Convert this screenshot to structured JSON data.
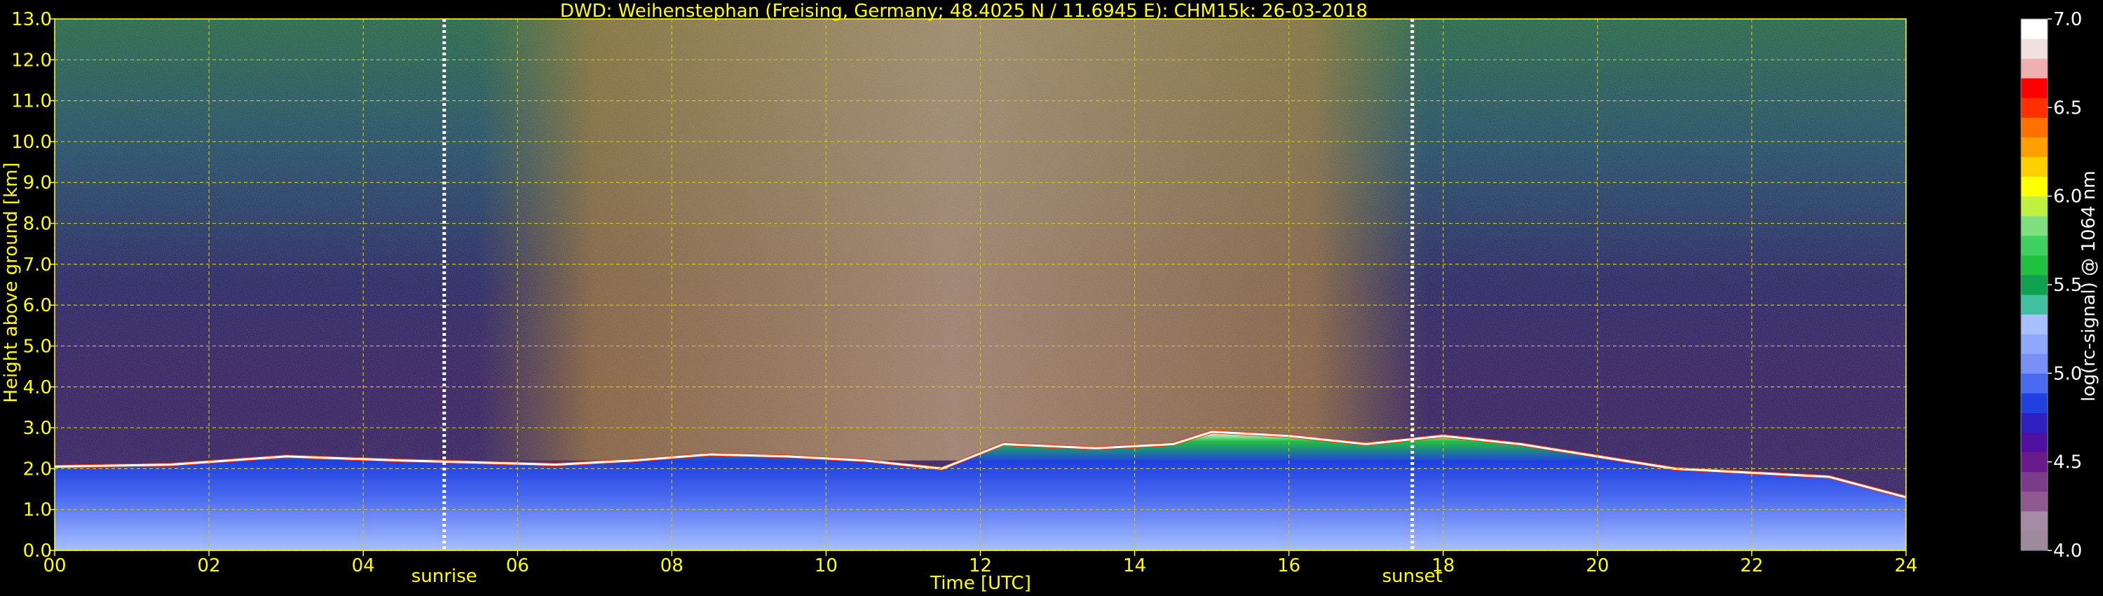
{
  "chart_data": {
    "type": "heatmap",
    "title": "DWD: Weihenstephan (Freising, Germany; 48.4025 N / 11.6945 E):    CHM15k: 26-03-2018",
    "xlabel": "Time [UTC]",
    "ylabel": "Height above ground [km]",
    "xlim": [
      0,
      24
    ],
    "ylim": [
      0,
      13
    ],
    "x_ticks": [
      "00",
      "02",
      "04",
      "06",
      "08",
      "10",
      "12",
      "14",
      "16",
      "18",
      "20",
      "22",
      "24"
    ],
    "x_tick_values": [
      0,
      2,
      4,
      6,
      8,
      10,
      12,
      14,
      16,
      18,
      20,
      22,
      24
    ],
    "y_ticks": [
      "0.0",
      "1.0",
      "2.0",
      "3.0",
      "4.0",
      "5.0",
      "6.0",
      "7.0",
      "8.0",
      "9.0",
      "10.0",
      "11.0",
      "12.0",
      "13.0"
    ],
    "y_tick_values": [
      0,
      1,
      2,
      3,
      4,
      5,
      6,
      7,
      8,
      9,
      10,
      11,
      12,
      13
    ],
    "grid": true,
    "markers": [
      {
        "label": "sunrise",
        "x": 5.05
      },
      {
        "label": "sunset",
        "x": 17.6
      }
    ],
    "colorbar": {
      "label": "log(rc-signal) @ 1064 nm",
      "range": [
        4.0,
        7.0
      ],
      "ticks": [
        "4.0",
        "4.5",
        "5.0",
        "5.5",
        "6.0",
        "6.5",
        "7.0"
      ],
      "tick_values": [
        4.0,
        4.5,
        5.0,
        5.5,
        6.0,
        6.5,
        7.0
      ],
      "colors": [
        "#9d8b9d",
        "#a58ca5",
        "#8f5a8f",
        "#7a3d8a",
        "#6a1a8a",
        "#5010a0",
        "#3020c0",
        "#2040e0",
        "#4a6af0",
        "#7890f8",
        "#90a8ff",
        "#a8c0ff",
        "#40c0a0",
        "#10a050",
        "#20c040",
        "#40d060",
        "#80e080",
        "#c0f040",
        "#ffff00",
        "#ffd000",
        "#ffa000",
        "#ff7000",
        "#ff3000",
        "#ff0000",
        "#f0b0b0",
        "#f0e0e0",
        "#ffffff"
      ]
    },
    "boundary_layer_top_km": [
      {
        "t": 0.0,
        "h": 2.05
      },
      {
        "t": 1.5,
        "h": 2.1
      },
      {
        "t": 3.0,
        "h": 2.3
      },
      {
        "t": 4.5,
        "h": 2.2
      },
      {
        "t": 5.5,
        "h": 2.15
      },
      {
        "t": 6.5,
        "h": 2.1
      },
      {
        "t": 7.5,
        "h": 2.2
      },
      {
        "t": 8.5,
        "h": 2.35
      },
      {
        "t": 9.5,
        "h": 2.3
      },
      {
        "t": 10.5,
        "h": 2.2
      },
      {
        "t": 11.5,
        "h": 2.0
      },
      {
        "t": 12.3,
        "h": 2.6
      },
      {
        "t": 13.5,
        "h": 2.5
      },
      {
        "t": 14.5,
        "h": 2.6
      },
      {
        "t": 15.0,
        "h": 2.9
      },
      {
        "t": 16.0,
        "h": 2.8
      },
      {
        "t": 17.0,
        "h": 2.6
      },
      {
        "t": 18.0,
        "h": 2.8
      },
      {
        "t": 19.0,
        "h": 2.6
      },
      {
        "t": 20.0,
        "h": 2.3
      },
      {
        "t": 21.0,
        "h": 2.0
      },
      {
        "t": 22.0,
        "h": 1.9
      },
      {
        "t": 23.0,
        "h": 1.8
      },
      {
        "t": 24.0,
        "h": 1.3
      }
    ]
  }
}
